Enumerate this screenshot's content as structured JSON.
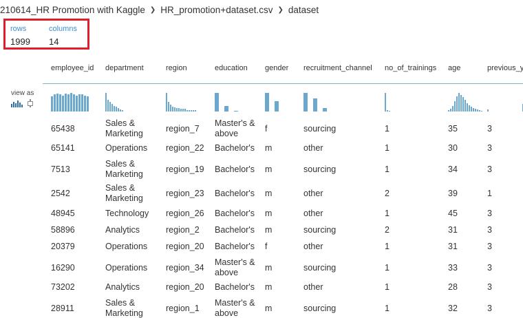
{
  "breadcrumb": {
    "items": [
      "210614_HR Promotion with Kaggle",
      "HR_promotion+dataset.csv",
      "dataset"
    ],
    "separator": "❯"
  },
  "stats": {
    "rows_label": "rows",
    "rows_value": "1999",
    "columns_label": "columns",
    "columns_value": "14"
  },
  "view_as": {
    "label": "view as",
    "icons": [
      "histogram-icon",
      "boxplot-icon"
    ]
  },
  "columns": [
    {
      "name": "employee_id"
    },
    {
      "name": "department"
    },
    {
      "name": "region"
    },
    {
      "name": "education"
    },
    {
      "name": "gender"
    },
    {
      "name": "recruitment_channel"
    },
    {
      "name": "no_of_trainings"
    },
    {
      "name": "age"
    },
    {
      "name": "previous_y"
    }
  ],
  "histograms": [
    [
      19,
      21,
      22,
      21,
      20,
      22,
      21,
      23,
      21,
      20,
      21,
      21,
      20,
      19
    ],
    [
      24,
      15,
      12,
      10,
      7,
      6,
      4,
      3,
      2
    ],
    [
      22,
      11,
      8,
      6,
      5,
      4,
      4,
      3,
      3,
      3,
      2,
      2,
      2,
      2,
      2
    ],
    [
      24,
      0,
      7,
      0,
      1
    ],
    [
      26,
      0,
      14
    ],
    [
      26,
      0,
      18,
      0,
      5
    ],
    [
      26,
      2,
      1,
      0,
      0,
      0,
      0,
      0,
      0
    ],
    [
      2,
      4,
      8,
      14,
      21,
      26,
      23,
      20,
      16,
      12,
      9,
      7,
      5,
      4,
      3,
      2,
      1
    ],
    [
      3,
      0,
      0,
      0,
      0,
      0,
      0,
      0,
      0,
      0,
      0,
      0,
      0,
      0,
      0,
      0,
      0,
      10,
      0,
      0,
      24
    ]
  ],
  "rows": [
    [
      "65438",
      "Sales & Marketing",
      "region_7",
      "Master's & above",
      "f",
      "sourcing",
      "1",
      "35",
      "3"
    ],
    [
      "65141",
      "Operations",
      "region_22",
      "Bachelor's",
      "m",
      "other",
      "1",
      "30",
      "3"
    ],
    [
      "7513",
      "Sales & Marketing",
      "region_19",
      "Bachelor's",
      "m",
      "sourcing",
      "1",
      "34",
      "3"
    ],
    [
      "2542",
      "Sales & Marketing",
      "region_23",
      "Bachelor's",
      "m",
      "other",
      "2",
      "39",
      "1"
    ],
    [
      "48945",
      "Technology",
      "region_26",
      "Bachelor's",
      "m",
      "other",
      "1",
      "45",
      "3"
    ],
    [
      "58896",
      "Analytics",
      "region_2",
      "Bachelor's",
      "m",
      "sourcing",
      "2",
      "31",
      "3"
    ],
    [
      "20379",
      "Operations",
      "region_20",
      "Bachelor's",
      "f",
      "other",
      "1",
      "31",
      "3"
    ],
    [
      "16290",
      "Operations",
      "region_34",
      "Master's & above",
      "m",
      "sourcing",
      "1",
      "33",
      "3"
    ],
    [
      "73202",
      "Analytics",
      "region_20",
      "Bachelor's",
      "m",
      "other",
      "1",
      "28",
      "3"
    ],
    [
      "28911",
      "Sales & Marketing",
      "region_1",
      "Master's & above",
      "m",
      "sourcing",
      "1",
      "32",
      "3"
    ]
  ],
  "colors": {
    "highlight_border": "#e01e2b",
    "link_blue": "#3d8fd6",
    "bar_blue": "#6aa8cf",
    "header_line": "#7bb3c9"
  }
}
